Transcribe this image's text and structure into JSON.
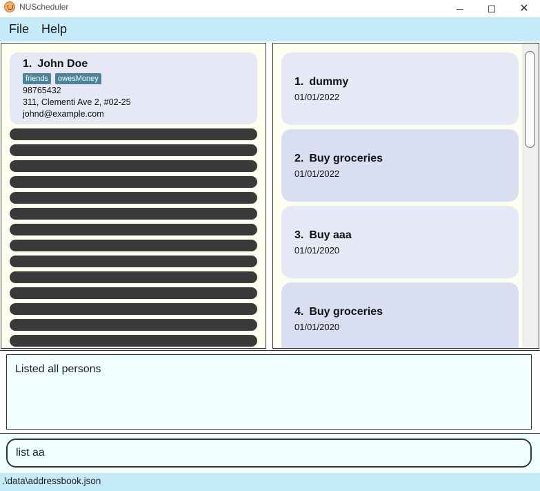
{
  "window": {
    "title": "NUScheduler"
  },
  "menu": {
    "items": [
      {
        "label": "File"
      },
      {
        "label": "Help"
      }
    ]
  },
  "person": {
    "index": "1.",
    "name": "John Doe",
    "tags": [
      "friends",
      "owesMoney"
    ],
    "phone": "98765432",
    "address": "311, Clementi Ave 2, #02-25",
    "email": "johnd@example.com"
  },
  "tasks": [
    {
      "index": "1.",
      "title": "dummy",
      "date": "01/01/2022"
    },
    {
      "index": "2.",
      "title": "Buy groceries",
      "date": "01/01/2022"
    },
    {
      "index": "3.",
      "title": "Buy aaa",
      "date": "01/01/2020"
    },
    {
      "index": "4.",
      "title": "Buy groceries",
      "date": "01/01/2020"
    }
  ],
  "result": {
    "message": "Listed all persons"
  },
  "command": {
    "value": "list aa"
  },
  "status": {
    "path": ".\\data\\addressbook.json"
  }
}
